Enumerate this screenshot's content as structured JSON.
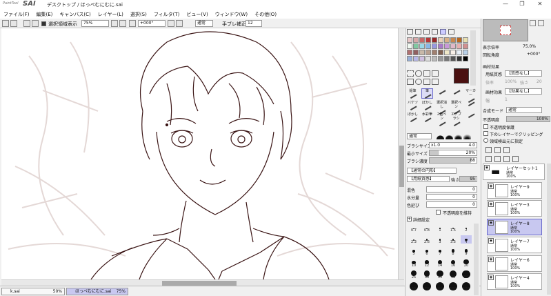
{
  "app": {
    "logo_small": "PaintTool",
    "logo_big": "SAI",
    "title": "デスクトップ / ほっぺむにむに.sai",
    "window_buttons": [
      "—",
      "❐",
      "✕"
    ]
  },
  "menu": [
    "ファイル(F)",
    "編集(E)",
    "キャンバス(C)",
    "レイヤー(L)",
    "選択(S)",
    "フィルタ(T)",
    "ビュー(V)",
    "ウィンドウ(W)",
    "その他(O)"
  ],
  "toolbar": {
    "selection_label": "選択領域表示",
    "zoom": "75%",
    "angle": "+000°",
    "blend": "通常",
    "stabilizer_label": "手ブレ補正",
    "stabilizer": "12"
  },
  "tabs": [
    {
      "name": "k.sai",
      "zoom": "50%"
    },
    {
      "name": "ほっぺむにむに.sai",
      "zoom": "75%"
    }
  ],
  "palette": {
    "colors": [
      "#e8c8c8",
      "#d8a8a8",
      "#c86868",
      "#b83838",
      "#982828",
      "#e8d0b8",
      "#d8b088",
      "#c88850",
      "#b86820",
      "#e8e0b0",
      "#f0f8f0",
      "#80c8a0",
      "#98d8e8",
      "#88b8e8",
      "#9898e0",
      "#a878c8",
      "#c898d8",
      "#e0b8c8",
      "#e8b0b0",
      "#d09090",
      "#b07070",
      "#906060",
      "#c8b8a8",
      "#b8a090",
      "#a08070",
      "#806050",
      "#f0e8c8",
      "#f8f0e8",
      "#e8f0f8",
      "#b8d0e8",
      "#98b0d8",
      "#b8b8e8",
      "#d0c0e0",
      "#ddd",
      "#bbb",
      "#999",
      "#777",
      "#555",
      "#333",
      "#000"
    ],
    "current_color": "#4a1010"
  },
  "tools": [
    {
      "label": "鉛筆",
      "sel": false
    },
    {
      "label": "筆",
      "sel": true
    },
    {
      "label": "",
      "sel": false
    },
    {
      "label": "",
      "sel": false
    },
    {
      "label": "マーカー",
      "sel": false
    },
    {
      "label": "バケツ",
      "sel": false
    },
    {
      "label": "ぼかし",
      "sel": false
    },
    {
      "label": "選択消し",
      "sel": false
    },
    {
      "label": "選択ペン",
      "sel": false
    },
    {
      "label": "",
      "sel": false
    },
    {
      "label": "ぼかし",
      "sel": false
    },
    {
      "label": "水彩筆",
      "sel": false
    },
    {
      "label": "2値ペン",
      "sel": false
    },
    {
      "label": "エアブラシ",
      "sel": false
    },
    {
      "label": "",
      "sel": false
    }
  ],
  "brush": {
    "mode": "通常",
    "size_label": "ブラシサイズ",
    "size_mult": "x1.0",
    "size": "4.0",
    "min_label": "最小サイズ",
    "min": "20%",
    "density_label": "ブラシ濃度",
    "density": "88",
    "shape": "【通常の円形】",
    "texture": "【用紙質感】",
    "strength_label": "強さ",
    "strength": "95",
    "blend_label": "混色",
    "blend": "0",
    "water_label": "水分量",
    "water": "0",
    "persist_label": "色延び",
    "persist": "0",
    "keep_opacity": "不透明度を維持",
    "detail": "詳細設定"
  },
  "sizes": [
    [
      "0.7",
      "0.8",
      "1",
      "1.5",
      "2"
    ],
    [
      "2.3",
      "2.6",
      "3",
      "3.5",
      "4"
    ],
    [
      "5",
      "6",
      "7",
      "8",
      "9"
    ],
    [
      "10",
      "12",
      "14",
      "16",
      "20"
    ],
    [
      "25",
      "30",
      "35",
      "40",
      "50"
    ],
    [
      "60",
      "70",
      "80",
      "100",
      "120"
    ]
  ],
  "nav": {
    "zoom_label": "表示倍率",
    "zoom": "75.0%",
    "angle_label": "回転角度",
    "angle": "+000°"
  },
  "layer_panel": {
    "paper_header": "画材効果",
    "paper_label": "用紙質感",
    "paper_value": "【質感なし】",
    "scale_label": "倍率",
    "scale": "100%",
    "strength_label": "強さ",
    "strength": "20",
    "effect_label": "画材効果",
    "effect_value": "【効果なし】",
    "width_label": "幅",
    "width": "1",
    "mode_label": "合成モード",
    "mode": "通常",
    "opacity_label": "不透明度",
    "opacity": "100%",
    "protect": "不透明度保護",
    "clip": "下のレイヤーでクリッピング",
    "select_src": "領域検出元に指定"
  },
  "layers": [
    {
      "name": "レイヤーセット1",
      "mode": "通常",
      "opacity": "100%",
      "folder": true,
      "sel": false
    },
    {
      "name": "レイヤー9",
      "mode": "通常",
      "opacity": "100%",
      "sel": false
    },
    {
      "name": "レイヤー3",
      "mode": "通常",
      "opacity": "100%",
      "sel": false
    },
    {
      "name": "レイヤー8",
      "mode": "通常",
      "opacity": "100%",
      "sel": true
    },
    {
      "name": "レイヤー7",
      "mode": "通常",
      "opacity": "100%",
      "sel": false
    },
    {
      "name": "レイヤー6",
      "mode": "通常",
      "opacity": "100%",
      "sel": false
    },
    {
      "name": "レイヤー4",
      "mode": "通常",
      "opacity": "100%",
      "sel": false
    }
  ]
}
